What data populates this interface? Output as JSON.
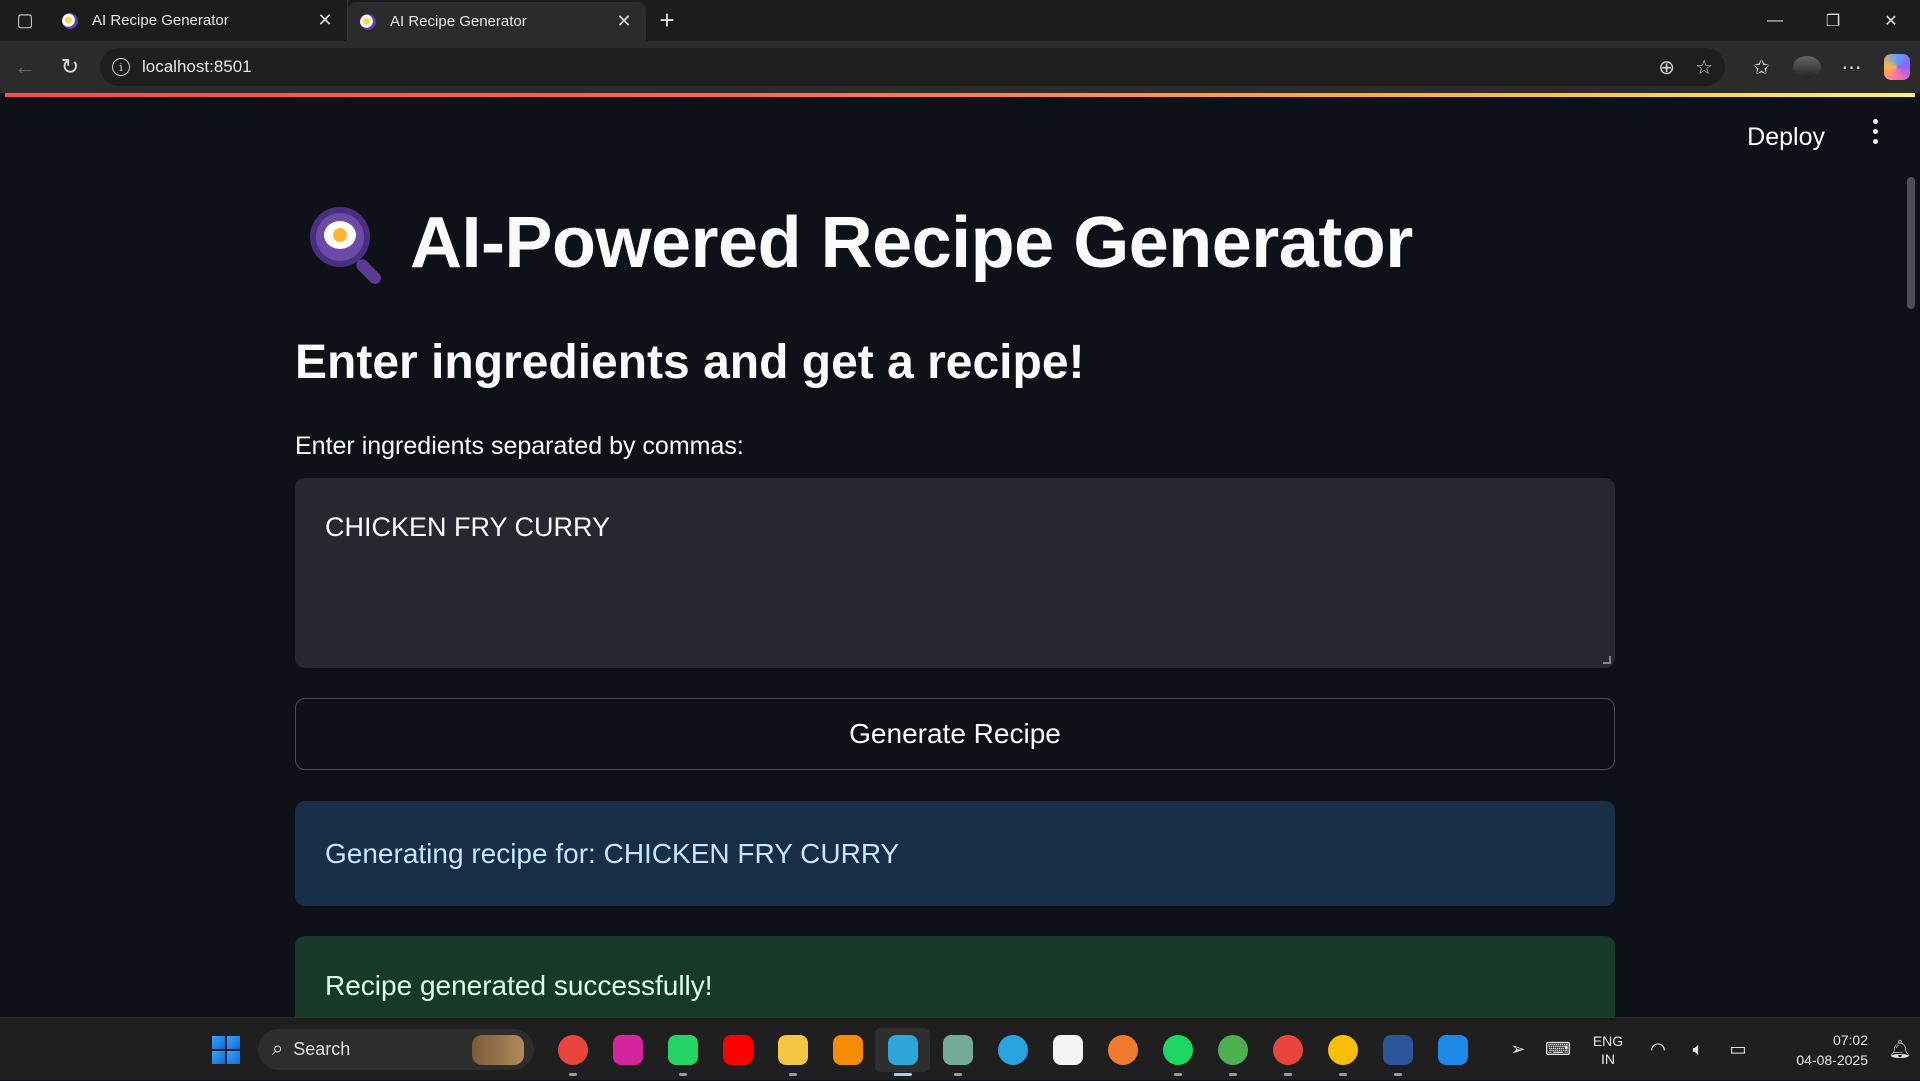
{
  "browser": {
    "tabs": [
      {
        "title": "AI Recipe Generator",
        "active": false
      },
      {
        "title": "AI Recipe Generator",
        "active": true
      }
    ],
    "url": "localhost:8501"
  },
  "header": {
    "deploy_label": "Deploy"
  },
  "main": {
    "title": "AI-Powered Recipe Generator",
    "subheader": "Enter ingredients and get a recipe!",
    "input_label": "Enter ingredients separated by commas:",
    "input_value": "CHICKEN FRY CURRY",
    "generate_button": "Generate Recipe",
    "info_message": "Generating recipe for: CHICKEN FRY CURRY",
    "success_message": "Recipe generated successfully!"
  },
  "taskbar": {
    "search_placeholder": "Search",
    "apps": [
      {
        "name": "chrome",
        "color": "#e8453c"
      },
      {
        "name": "instagram",
        "color": "#d6249f"
      },
      {
        "name": "whatsapp",
        "color": "#25d366"
      },
      {
        "name": "youtube",
        "color": "#ff0000"
      },
      {
        "name": "file-explorer",
        "color": "#f4c542"
      },
      {
        "name": "vlc",
        "color": "#f48b00"
      },
      {
        "name": "edge",
        "color": "#2fa6d9"
      },
      {
        "name": "chatgpt",
        "color": "#74aa9c"
      },
      {
        "name": "telegram",
        "color": "#2aa3df"
      },
      {
        "name": "microsoft-store",
        "color": "#f3f3f3"
      },
      {
        "name": "badge-app",
        "color": "#f07b2e"
      },
      {
        "name": "spotify",
        "color": "#1ed760"
      },
      {
        "name": "chrome-profile-1",
        "color": "#4caf50"
      },
      {
        "name": "chrome-profile-2",
        "color": "#e8453c"
      },
      {
        "name": "chrome-profile-3",
        "color": "#fbbc05"
      },
      {
        "name": "word",
        "color": "#2b579a"
      },
      {
        "name": "vscode",
        "color": "#1e88e5"
      }
    ],
    "language": "ENG",
    "region": "IN",
    "time": "07:02",
    "date": "04-08-2025"
  }
}
